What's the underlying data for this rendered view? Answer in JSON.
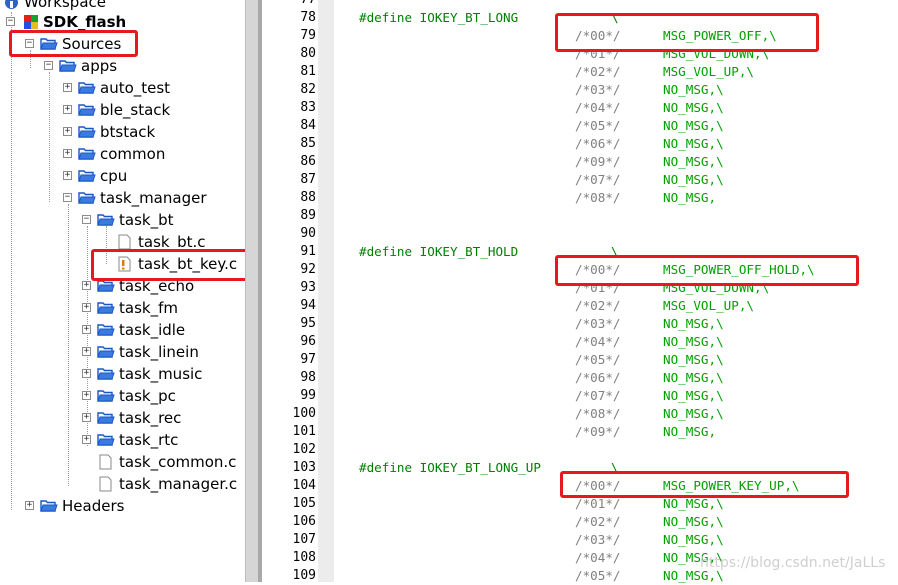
{
  "tree": {
    "workspace": "Workspace",
    "project": "SDK_flash",
    "sources": "Sources",
    "apps": "apps",
    "folders": [
      "auto_test",
      "ble_stack",
      "btstack",
      "common",
      "cpu"
    ],
    "task_manager": "task_manager",
    "task_bt": "task_bt",
    "task_bt_c": "task_bt.c",
    "task_bt_key_c": "task_bt_key.c",
    "task_folders": [
      "task_echo",
      "task_fm",
      "task_idle",
      "task_linein",
      "task_music",
      "task_pc",
      "task_rec",
      "task_rtc"
    ],
    "files": [
      "task_common.c",
      "task_manager.c"
    ],
    "headers": "Headers"
  },
  "editor": {
    "top_line": "77",
    "lines": [
      {
        "n": "78",
        "define": "#define IOKEY_BT_LONG",
        "tail": "\\"
      },
      {
        "n": "79",
        "idx": "/*00*/",
        "msg": "MSG_POWER_OFF,\\"
      },
      {
        "n": "80",
        "idx": "/*01*/",
        "msg": "MSG_VOL_DOWN,\\"
      },
      {
        "n": "81",
        "idx": "/*02*/",
        "msg": "MSG_VOL_UP,\\"
      },
      {
        "n": "82",
        "idx": "/*03*/",
        "msg": "NO_MSG,\\"
      },
      {
        "n": "83",
        "idx": "/*04*/",
        "msg": "NO_MSG,\\"
      },
      {
        "n": "84",
        "idx": "/*05*/",
        "msg": "NO_MSG,\\"
      },
      {
        "n": "85",
        "idx": "/*06*/",
        "msg": "NO_MSG,\\"
      },
      {
        "n": "86",
        "idx": "/*09*/",
        "msg": "NO_MSG,\\"
      },
      {
        "n": "87",
        "idx": "/*07*/",
        "msg": "NO_MSG,\\"
      },
      {
        "n": "88",
        "idx": "/*08*/",
        "msg": "NO_MSG,"
      },
      {
        "n": "89"
      },
      {
        "n": "90"
      },
      {
        "n": "91",
        "define": "#define IOKEY_BT_HOLD",
        "tail": "\\"
      },
      {
        "n": "92",
        "idx": "/*00*/",
        "msg": "MSG_POWER_OFF_HOLD,\\"
      },
      {
        "n": "93",
        "idx": "/*01*/",
        "msg": "MSG_VOL_DOWN,\\"
      },
      {
        "n": "94",
        "idx": "/*02*/",
        "msg": "MSG_VOL_UP,\\"
      },
      {
        "n": "95",
        "idx": "/*03*/",
        "msg": "NO_MSG,\\"
      },
      {
        "n": "96",
        "idx": "/*04*/",
        "msg": "NO_MSG,\\"
      },
      {
        "n": "97",
        "idx": "/*05*/",
        "msg": "NO_MSG,\\"
      },
      {
        "n": "98",
        "idx": "/*06*/",
        "msg": "NO_MSG,\\"
      },
      {
        "n": "99",
        "idx": "/*07*/",
        "msg": "NO_MSG,\\"
      },
      {
        "n": "100",
        "idx": "/*08*/",
        "msg": "NO_MSG,\\"
      },
      {
        "n": "101",
        "idx": "/*09*/",
        "msg": "NO_MSG,"
      },
      {
        "n": "102"
      },
      {
        "n": "103",
        "define": "#define IOKEY_BT_LONG_UP",
        "tail": "\\"
      },
      {
        "n": "104",
        "idx": "/*00*/",
        "msg": "MSG_POWER_KEY_UP,\\"
      },
      {
        "n": "105",
        "idx": "/*01*/",
        "msg": "NO_MSG,\\"
      },
      {
        "n": "106",
        "idx": "/*02*/",
        "msg": "NO_MSG,\\"
      },
      {
        "n": "107",
        "idx": "/*03*/",
        "msg": "NO_MSG,\\"
      },
      {
        "n": "108",
        "idx": "/*04*/",
        "msg": "NO_MSG,\\"
      },
      {
        "n": "109",
        "idx": "/*05*/",
        "msg": "NO_MSG,\\"
      }
    ]
  },
  "watermark": "https://blog.csdn.net/JaLLs",
  "colors": {
    "highlight": "#e8191c",
    "keyword": "#008000",
    "comment": "#808080",
    "message": "#00a000"
  }
}
